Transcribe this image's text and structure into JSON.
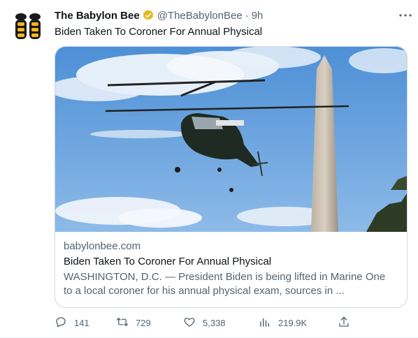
{
  "author": {
    "name": "The Babylon Bee",
    "handle": "@TheBabylonBee",
    "separator": "·",
    "time": "9h"
  },
  "tweet": {
    "text": "Biden Taken To Coroner For Annual Physical"
  },
  "card": {
    "domain": "babylonbee.com",
    "title": "Biden Taken To Coroner For Annual Physical",
    "description_line1": "WASHINGTON, D.C. — President Biden is being lifted in Marine One",
    "description_line2": "to a local coroner for his annual physical exam, sources in ..."
  },
  "actions": {
    "replies": "141",
    "retweets": "729",
    "likes": "5,338",
    "views": "219.9K"
  },
  "icons": [
    "bee-logo-icon",
    "verified-badge-icon",
    "more-icon",
    "reply-icon",
    "retweet-icon",
    "like-icon",
    "views-icon",
    "share-icon"
  ],
  "colors": {
    "text": "#0f1419",
    "secondary": "#536471",
    "border": "#cfd9de",
    "verified": "#e2b719"
  }
}
